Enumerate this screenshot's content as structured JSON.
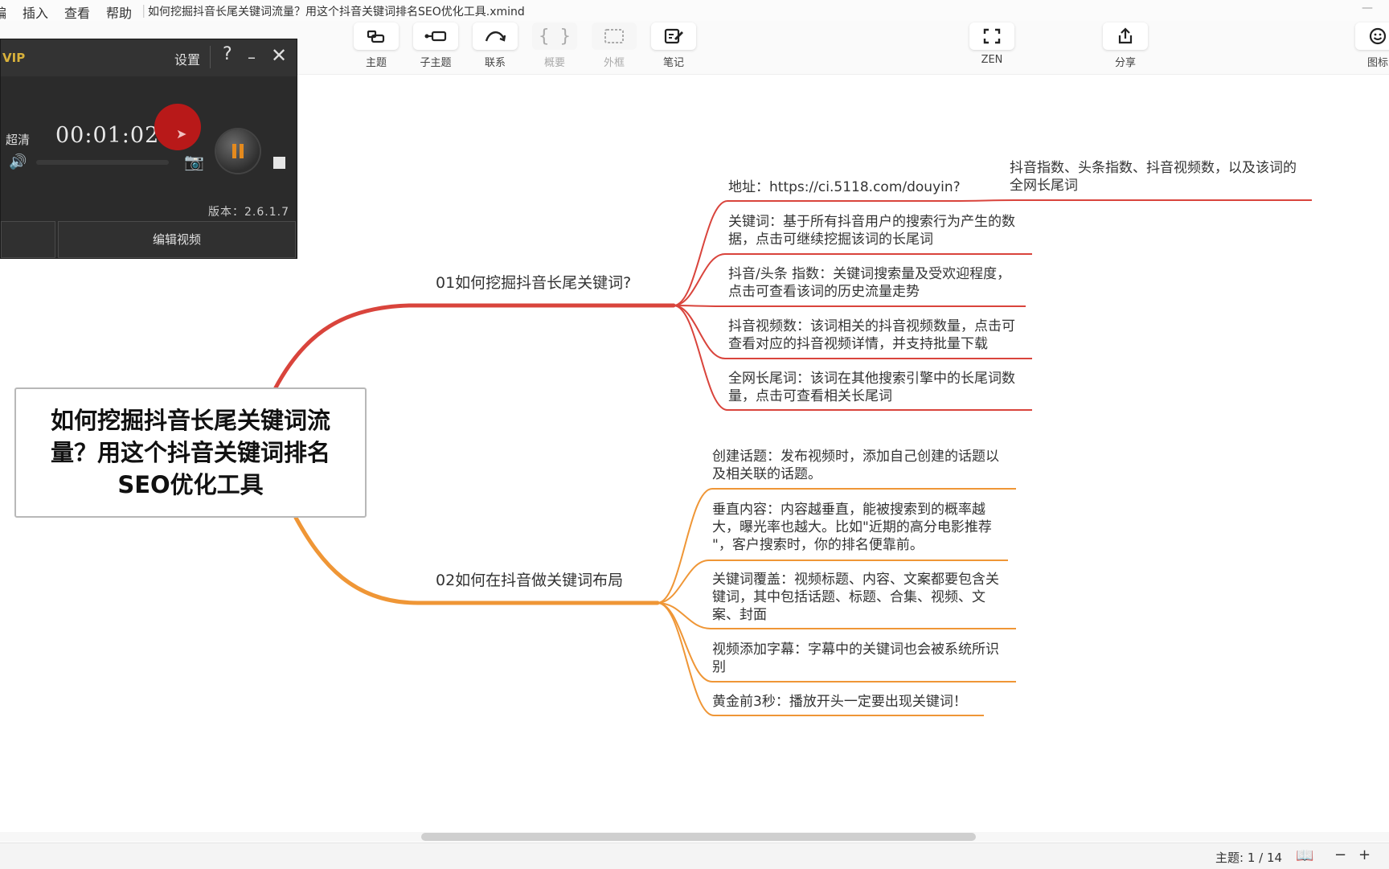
{
  "menu": {
    "partial_left": "编",
    "items": [
      "插入",
      "查看",
      "帮助"
    ],
    "doc_title": "如何挖掘抖音长尾关键词流量？用这个抖音关键词排名SEO优化工具.xmind"
  },
  "toolbar": {
    "buttons": [
      {
        "label": "主题",
        "icon": "topic-icon",
        "enabled": true
      },
      {
        "label": "子主题",
        "icon": "subtopic-icon",
        "enabled": true
      },
      {
        "label": "联系",
        "icon": "relationship-icon",
        "enabled": true
      },
      {
        "label": "概要",
        "icon": "summary-icon",
        "enabled": false
      },
      {
        "label": "外框",
        "icon": "boundary-icon",
        "enabled": false
      },
      {
        "label": "笔记",
        "icon": "notes-icon",
        "enabled": true
      },
      {
        "label": "ZEN",
        "icon": "zen-icon",
        "enabled": true
      },
      {
        "label": "分享",
        "icon": "share-icon",
        "enabled": true
      },
      {
        "label": "图标",
        "icon": "emoji-icon",
        "enabled": true
      }
    ]
  },
  "recorder": {
    "vip": "VIP",
    "settings": "设置",
    "help": "?",
    "minimize": "–",
    "close": "✕",
    "quality": "超清",
    "time": "00:01:02",
    "version": "版本：2.6.1.7",
    "edit_video": "编辑视频"
  },
  "mindmap": {
    "central": "如何挖掘抖音长尾关键词流量？用这个抖音关键词排名SEO优化工具",
    "branch1": {
      "title": "01如何挖掘抖音长尾关键词?",
      "color": "#d9443c",
      "children": [
        {
          "lines": [
            "地址：https://ci.5118.com/douyin?"
          ]
        },
        {
          "lines": [
            "关键词：基于所有抖音用户的搜索行为产生的数",
            "据，点击可继续挖掘该词的长尾词"
          ]
        },
        {
          "lines": [
            "抖音/头条 指数：关键词搜索量及受欢迎程度，",
            "点击可查看该词的历史流量走势"
          ]
        },
        {
          "lines": [
            "抖音视频数：该词相关的抖音视频数量，点击可",
            "查看对应的抖音视频详情，并支持批量下载"
          ]
        },
        {
          "lines": [
            "全网长尾词：该词在其他搜索引擎中的长尾词数",
            "量，点击可查看相关长尾词"
          ]
        }
      ],
      "sub": {
        "lines": [
          "抖音指数、头条指数、抖音视频数，以及该词的",
          "全网长尾词"
        ]
      }
    },
    "branch2": {
      "title": "02如何在抖音做关键词布局",
      "color": "#ef9636",
      "children": [
        {
          "lines": [
            "创建话题：发布视频时，添加自己创建的话题以",
            "及相关联的话题。"
          ]
        },
        {
          "lines": [
            "垂直内容：内容越垂直，能被搜索到的概率越",
            "大，曝光率也越大。比如\"近期的高分电影推荐",
            "\"，客户搜索时，你的排名便靠前。"
          ]
        },
        {
          "lines": [
            "关键词覆盖：视频标题、内容、文案都要包含关",
            "键词，其中包括话题、标题、合集、视频、文",
            "案、封面"
          ]
        },
        {
          "lines": [
            "视频添加字幕：字幕中的关键词也会被系统所识",
            "别"
          ]
        },
        {
          "lines": [
            "黄金前3秒：播放开头一定要出现关键词！"
          ]
        }
      ]
    }
  },
  "status": {
    "topic_count": "主题: 1 / 14",
    "zoom_out": "−",
    "zoom_in": "+"
  }
}
